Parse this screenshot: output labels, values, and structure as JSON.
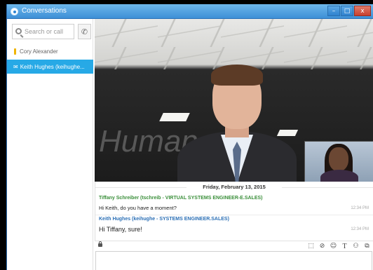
{
  "window": {
    "title": "Conversations",
    "controls": {
      "minimize": "–",
      "maximize": "□",
      "close": "x"
    }
  },
  "sidebar": {
    "search": {
      "placeholder": "Search or call",
      "value": ""
    },
    "call_icon": "phone-icon",
    "contacts": [
      {
        "name": "Cory Alexander",
        "status": "away",
        "status_color": "#f0b400",
        "selected": false
      },
      {
        "name": "Keith Hughes (keihughe...",
        "icon": "chat-bubble-icon",
        "selected": true
      }
    ],
    "selected_color": "#27a9e6"
  },
  "video": {
    "background_text": "Human",
    "main_participant": "remote-video",
    "self_view": "self-view-pip"
  },
  "chat": {
    "date": "Friday, February 13, 2015",
    "messages": [
      {
        "sender": "Tiffany Schreiber (tschreib - VIRTUAL SYSTEMS ENGINEER-E.SALES)",
        "sender_color": "#3a8f3a",
        "text": "Hi Keith, do you have a moment?",
        "time": "12:34 PM"
      },
      {
        "sender": "Keith Hughes (keihughe - SYSTEMS ENGINEER.SALES)",
        "sender_color": "#2b6fb5",
        "text": "Hi Tiffany, sure!",
        "time": "12:34 PM"
      }
    ]
  },
  "compose": {
    "toolbar": [
      "screen-capture-icon",
      "attach-icon",
      "emoticon-icon",
      "text-format-icon",
      "add-participant-icon",
      "pop-out-icon"
    ],
    "toolbar_glyphs": {
      "text_format": "T"
    },
    "value": ""
  }
}
